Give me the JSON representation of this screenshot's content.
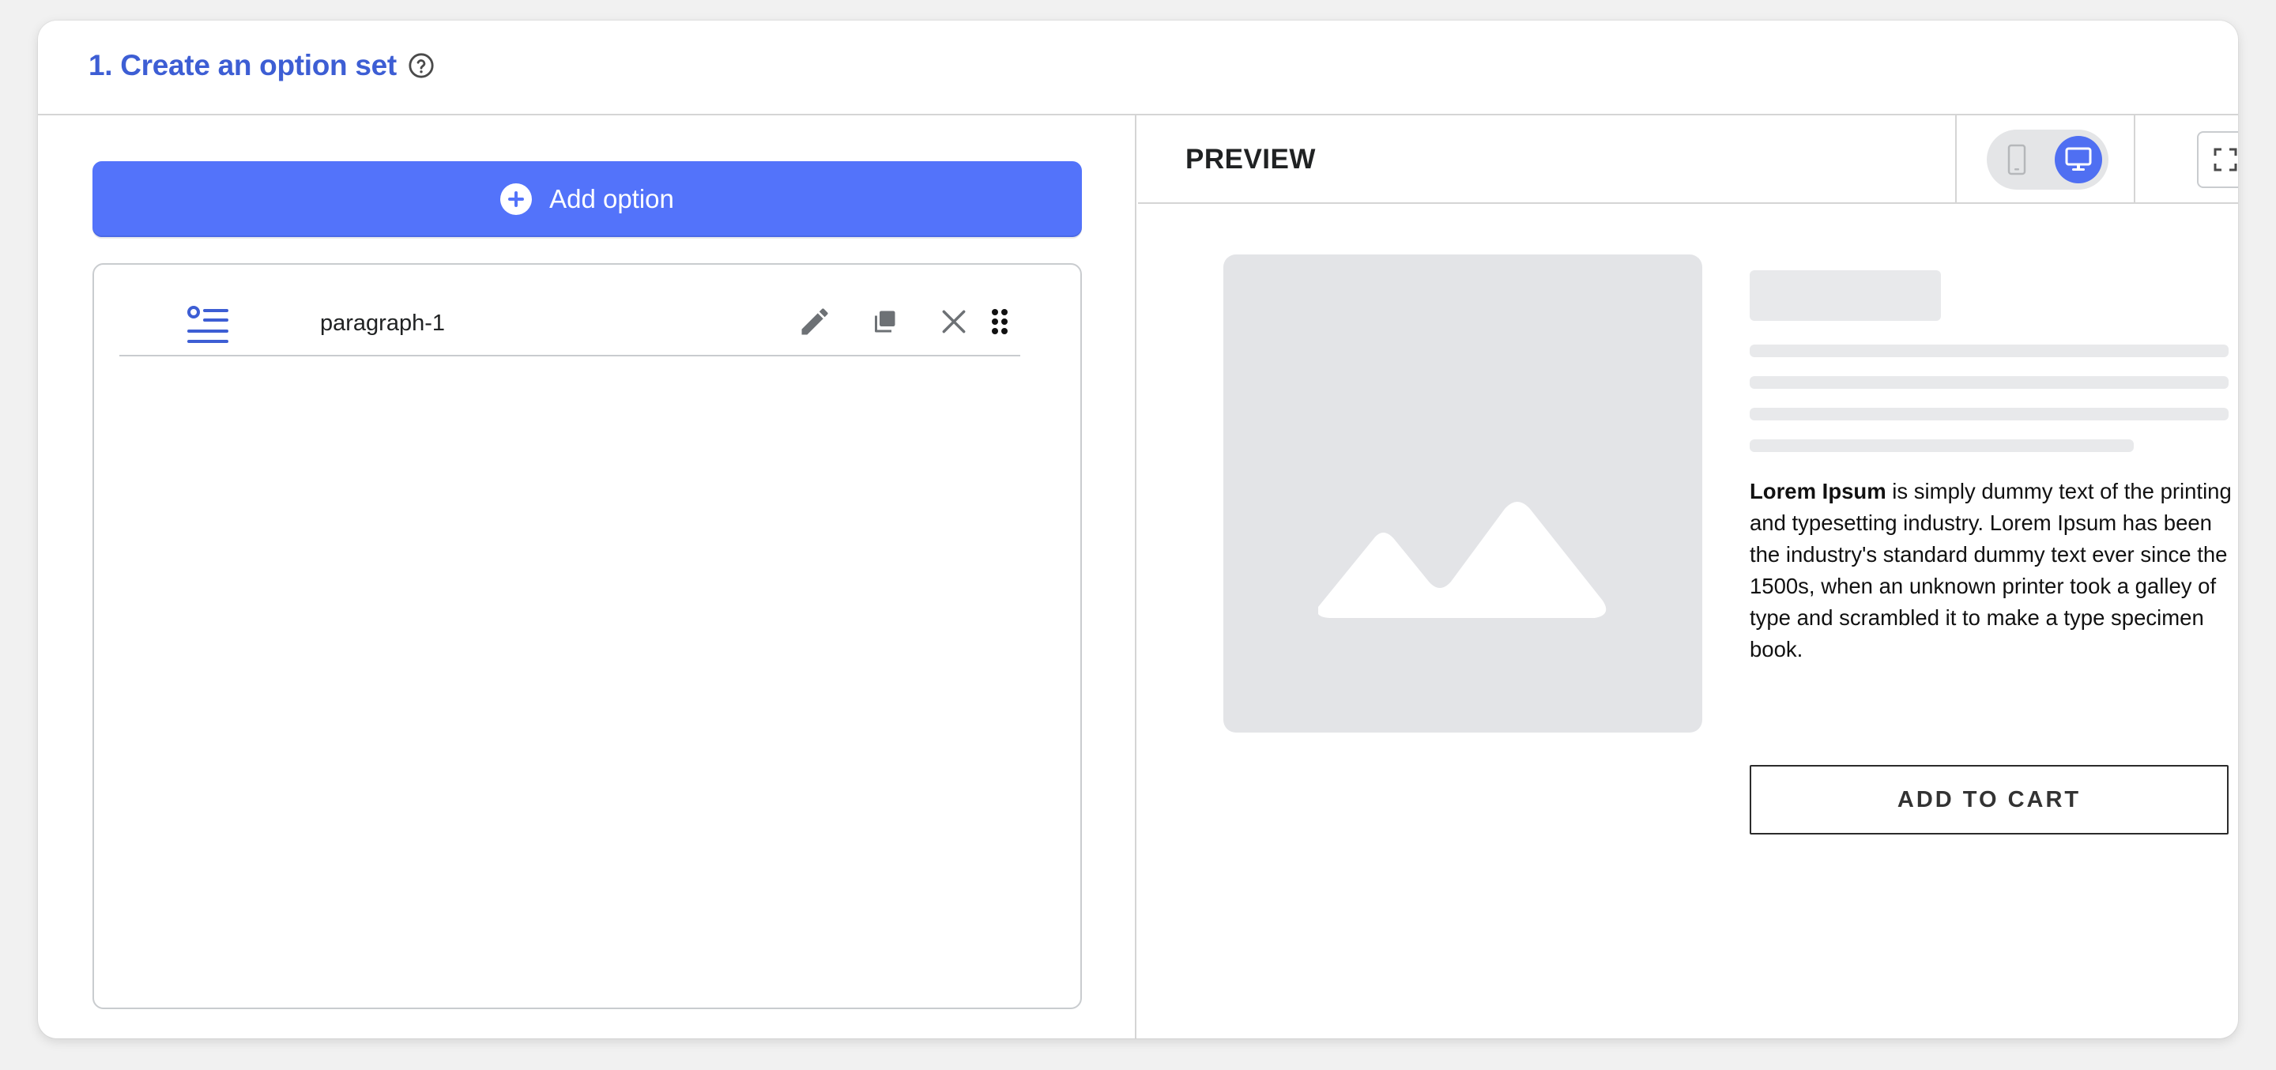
{
  "section": {
    "title": "1. Create an option set",
    "help_icon": "question-circle-icon"
  },
  "left": {
    "add_option_label": "Add option",
    "add_option_icon": "plus-circle-icon",
    "options": [
      {
        "label": "paragraph-1",
        "type_icon": "paragraph-list-icon",
        "actions": [
          "pencil-icon",
          "duplicate-icon",
          "close-icon",
          "drag-handle-icon"
        ]
      }
    ]
  },
  "preview": {
    "title": "PREVIEW",
    "device_modes": [
      "mobile-icon",
      "desktop-icon"
    ],
    "active_device": "desktop",
    "fullscreen_icon": "expand-icon",
    "image_icon": "image-placeholder-icon",
    "description_bold": "Lorem Ipsum",
    "description_rest": " is simply dummy text of the printing and typesetting industry. Lorem Ipsum has been the industry's standard dummy text ever since the 1500s, when an unknown printer took a galley of type and scrambled it to make a type specimen book.",
    "add_to_cart_label": "ADD TO CART"
  },
  "colors": {
    "accent": "#5373fa",
    "title": "#3d5ed4",
    "skeleton": "#e3e4e7"
  }
}
